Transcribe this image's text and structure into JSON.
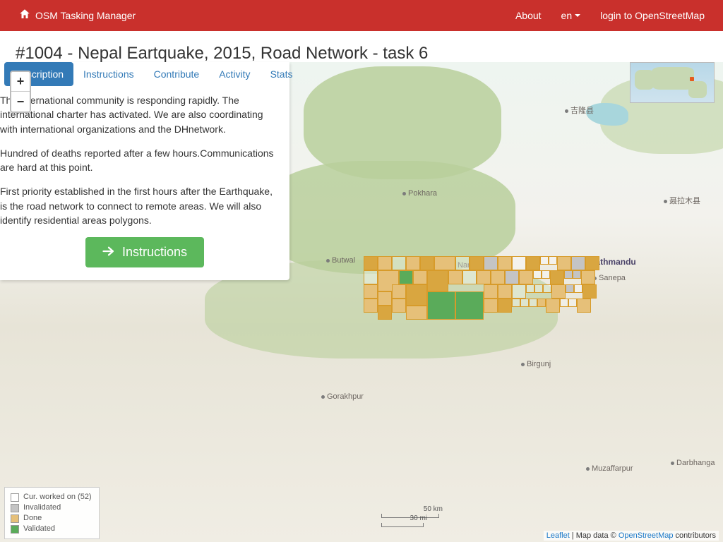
{
  "navbar": {
    "brand": "OSM Tasking Manager",
    "about": "About",
    "lang": "en",
    "login": "login to OpenStreetMap"
  },
  "project": {
    "title": "#1004 - Nepal Eartquake, 2015, Road Network - task 6"
  },
  "tabs": {
    "description": "Description",
    "instructions": "Instructions",
    "contribute": "Contribute",
    "activity": "Activity",
    "stats": "Stats"
  },
  "description": {
    "p1": "The international community is responding rapidly. The international charter has activated. We are also coordinating with international organizations and the DHnetwork.",
    "p2": "Hundred of deaths reported after a few hours.Communications are hard at this point.",
    "p3": "First priority established in the first hours after the Earthquake, is the road network to connect to remote areas. We will also identify residential areas polygons."
  },
  "buttons": {
    "instructions": "Instructions"
  },
  "zoom": {
    "in": "+",
    "out": "−"
  },
  "cities": {
    "jilong": "吉隆县",
    "pokhara": "Pokhara",
    "butwal": "Butwal",
    "narayangadh": "Narayangadh",
    "kathmandu": "Kathmandu",
    "sanepa": "Sanepa",
    "nielamu": "聂拉木县",
    "birgunj": "Birgunj",
    "gorakhpur": "Gorakhpur",
    "muzaffarpur": "Muzaffarpur",
    "darbhanga": "Darbhanga"
  },
  "legend": {
    "worked": "Cur. worked on (52)",
    "invalidated": "Invalidated",
    "done": "Done",
    "validated": "Validated"
  },
  "scale": {
    "km": "50 km",
    "mi": "30 mi"
  },
  "attribution": {
    "leaflet": "Leaflet",
    "mid": " | Map data © ",
    "osm": "OpenStreetMap",
    "suffix": " contributors"
  }
}
